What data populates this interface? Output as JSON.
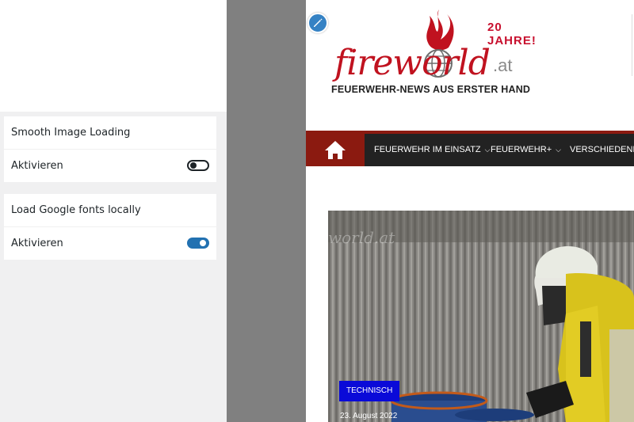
{
  "customizer": {
    "sections": [
      {
        "title": "Smooth Image Loading",
        "toggle_label": "Aktivieren",
        "enabled": false
      },
      {
        "title": "Load Google fonts locally",
        "toggle_label": "Aktivieren",
        "enabled": true
      }
    ]
  },
  "preview": {
    "edit_icon": "pencil-icon",
    "logo": {
      "word": "fireworld",
      "tld": ".at",
      "anniversary": "20 JAHRE!",
      "tagline": "FEUERWEHR-NEWS AUS ERSTER HAND"
    },
    "nav": {
      "home_icon": "home-icon",
      "items": [
        {
          "label": "FEUERWEHR IM EINSATZ",
          "has_dropdown": true
        },
        {
          "label": "FEUERWEHR+",
          "has_dropdown": true
        },
        {
          "label": "VERSCHIEDENES",
          "has_dropdown": false
        }
      ]
    },
    "article": {
      "category": "TECHNISCH",
      "date": "23. August 2022",
      "watermark": "world.at"
    }
  },
  "colors": {
    "accent_blue": "#2271b1",
    "brand_red": "#c0121f",
    "nav_red": "#8b1a10",
    "badge_blue": "#0a0ad8"
  }
}
